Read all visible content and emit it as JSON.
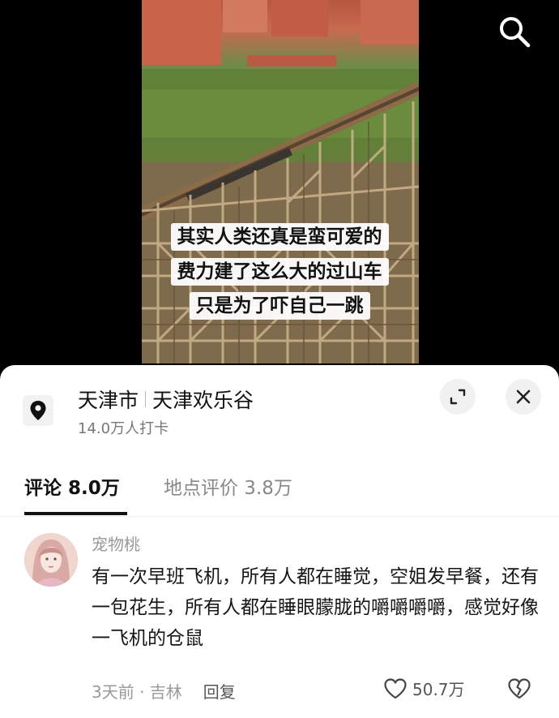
{
  "video": {
    "captions": [
      "其实人类还真是蛮可爱的",
      "费力建了这么大的过山车",
      "只是为了吓自己一跳"
    ]
  },
  "location": {
    "city": "天津市",
    "place": "天津欢乐谷",
    "checkins": "14.0万人打卡"
  },
  "tabs": [
    {
      "label": "评论 8.0万",
      "active": true
    },
    {
      "label": "地点评价 3.8万",
      "active": false
    }
  ],
  "comment": {
    "username": "宠物桃",
    "text": "有一次早班飞机，所有人都在睡觉，空姐发早餐，还有一包花生，所有人都在睡眼朦胧的嚼嚼嚼嚼，感觉好像一飞机的仓鼠",
    "time_location": "3天前 · 吉林",
    "reply_label": "回复",
    "likes": "50.7万"
  },
  "icons": {
    "search": "search-icon",
    "location": "location-pin-icon",
    "expand": "expand-icon",
    "close": "close-icon",
    "like": "heart-icon",
    "dislike": "broken-heart-icon"
  }
}
